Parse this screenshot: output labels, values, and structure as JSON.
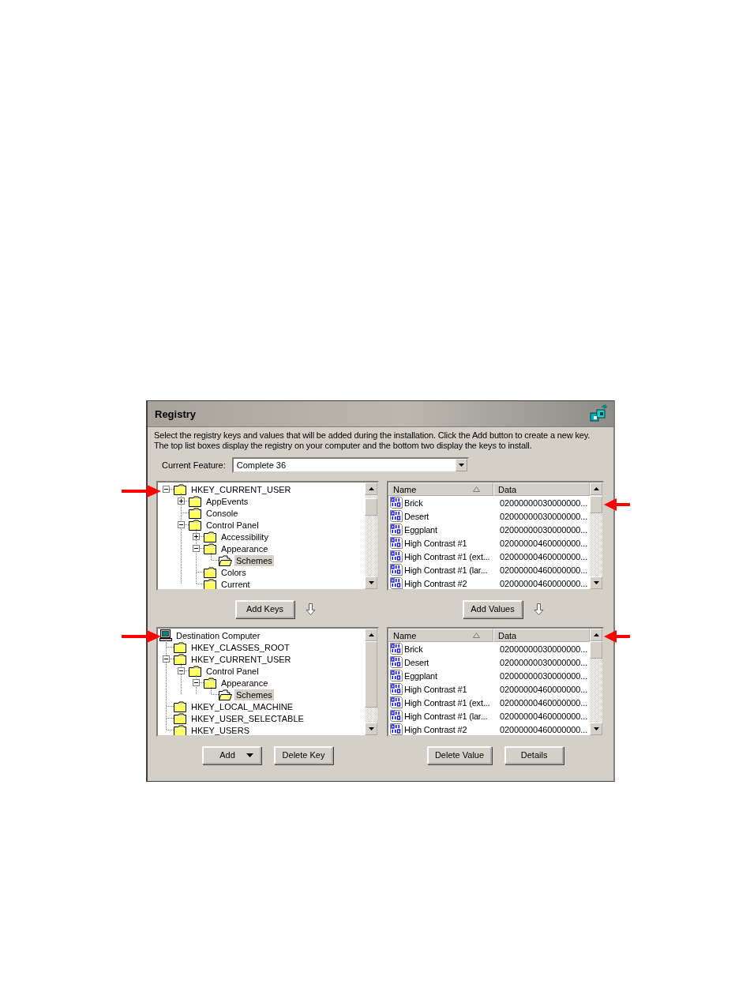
{
  "dialog": {
    "title": "Registry",
    "description": "Select the registry keys and values that will be added during the installation. Click the Add button to create a new key. The top list boxes display the registry on your computer and the bottom two display the keys to install.",
    "current_feature": {
      "label": "Current Feature:",
      "value": "Complete 36"
    }
  },
  "source_keys": {
    "nodes": [
      {
        "label": "HKEY_CURRENT_USER",
        "kind": "folder",
        "expanded": true,
        "selected": false,
        "children": [
          {
            "label": "AppEvents",
            "kind": "folder",
            "expanded": false,
            "selected": false
          },
          {
            "label": "Console",
            "kind": "folder",
            "selected": false
          },
          {
            "label": "Control Panel",
            "kind": "folder",
            "expanded": true,
            "selected": false,
            "children": [
              {
                "label": "Accessibility",
                "kind": "folder",
                "expanded": false,
                "selected": false
              },
              {
                "label": "Appearance",
                "kind": "folder",
                "expanded": true,
                "selected": false,
                "children": [
                  {
                    "label": "Schemes",
                    "kind": "folder",
                    "selected": true
                  }
                ]
              },
              {
                "label": "Colors",
                "kind": "folder",
                "selected": false
              },
              {
                "label": "Current",
                "kind": "folder",
                "selected": false
              }
            ]
          }
        ]
      }
    ]
  },
  "source_values": {
    "columns": [
      {
        "label": "Name",
        "sorted": true
      },
      {
        "label": "Data",
        "sorted": false
      }
    ],
    "rows": [
      {
        "name": "Brick",
        "data": "02000000030000000..."
      },
      {
        "name": "Desert",
        "data": "02000000030000000..."
      },
      {
        "name": "Eggplant",
        "data": "02000000030000000..."
      },
      {
        "name": "High Contrast #1",
        "data": "02000000460000000..."
      },
      {
        "name": "High Contrast #1 (ext...",
        "data": "02000000460000000..."
      },
      {
        "name": "High Contrast #1 (lar...",
        "data": "02000000460000000..."
      },
      {
        "name": "High Contrast #2",
        "data": "02000000460000000..."
      }
    ]
  },
  "add_keys_button": "Add Keys",
  "add_values_button": "Add Values",
  "destination_keys": {
    "nodes": [
      {
        "label": "Destination Computer",
        "kind": "computer",
        "selected": false,
        "children": [
          {
            "label": "HKEY_CLASSES_ROOT",
            "kind": "folder",
            "selected": false
          },
          {
            "label": "HKEY_CURRENT_USER",
            "kind": "folder",
            "expanded": true,
            "selected": false,
            "children": [
              {
                "label": "Control Panel",
                "kind": "folder",
                "expanded": true,
                "selected": false,
                "children": [
                  {
                    "label": "Appearance",
                    "kind": "folder",
                    "expanded": true,
                    "selected": false,
                    "children": [
                      {
                        "label": "Schemes",
                        "kind": "folder",
                        "selected": true
                      }
                    ]
                  }
                ]
              }
            ]
          },
          {
            "label": "HKEY_LOCAL_MACHINE",
            "kind": "folder",
            "selected": false
          },
          {
            "label": "HKEY_USER_SELECTABLE",
            "kind": "folder",
            "selected": false
          },
          {
            "label": "HKEY_USERS",
            "kind": "folder",
            "selected": false
          }
        ]
      }
    ]
  },
  "destination_values": {
    "columns": [
      {
        "label": "Name",
        "sorted": true
      },
      {
        "label": "Data",
        "sorted": false
      }
    ],
    "rows": [
      {
        "name": "Brick",
        "data": "02000000030000000..."
      },
      {
        "name": "Desert",
        "data": "02000000030000000..."
      },
      {
        "name": "Eggplant",
        "data": "02000000030000000..."
      },
      {
        "name": "High Contrast #1",
        "data": "02000000460000000..."
      },
      {
        "name": "High Contrast #1 (ext...",
        "data": "02000000460000000..."
      },
      {
        "name": "High Contrast #1 (lar...",
        "data": "02000000460000000..."
      },
      {
        "name": "High Contrast #2",
        "data": "02000000460000000..."
      }
    ]
  },
  "key_buttons": [
    {
      "label": "Add",
      "kind": "dropdown"
    },
    {
      "label": "Delete Key",
      "kind": "plain"
    }
  ],
  "value_buttons": [
    {
      "label": "Delete Value",
      "kind": "plain"
    },
    {
      "label": "Details",
      "kind": "plain"
    }
  ]
}
